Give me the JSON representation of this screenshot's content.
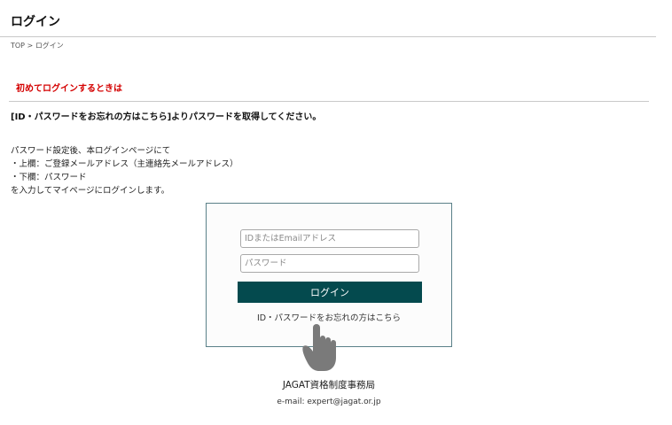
{
  "header": {
    "title": "ログイン"
  },
  "breadcrumb": {
    "top": "TOP",
    "separator": " > ",
    "current": "ログイン"
  },
  "notice": {
    "first_login": "初めてログインするときは",
    "instruction": "[ID・パスワードをお忘れの方はこちら]よりパスワードを取得してください。"
  },
  "description": {
    "lines": [
      "パスワード設定後、本ログインページにて",
      "・上欄：ご登録メールアドレス（主連絡先メールアドレス）",
      "・下欄：パスワード",
      "を入力してマイページにログインします。"
    ]
  },
  "login_form": {
    "id_placeholder": "IDまたはEmailアドレス",
    "id_value": "",
    "password_placeholder": "パスワード",
    "password_value": "",
    "submit_label": "ログイン",
    "forgot_link": "ID・パスワードをお忘れの方はこちら"
  },
  "icons": {
    "pointer": "pointing-hand-icon"
  },
  "contact": {
    "org": "JAGAT資格制度事務局",
    "email": "e-mail: expert@jagat.or.jp"
  },
  "colors": {
    "accent_red": "#d40000",
    "button_bg": "#044a4e",
    "box_border": "#5a8088",
    "hand": "#7a7a7a"
  }
}
